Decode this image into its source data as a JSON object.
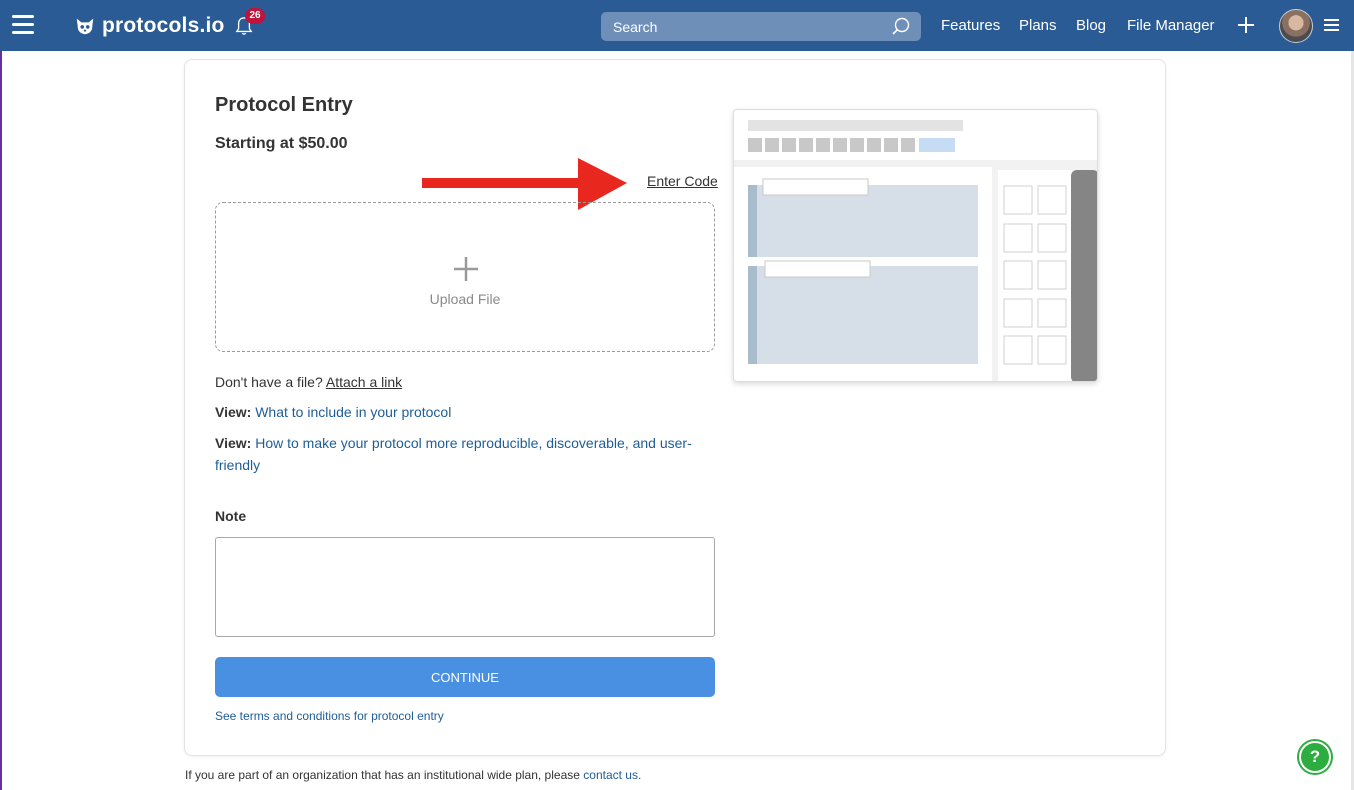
{
  "header": {
    "brand": "protocols.io",
    "notification_count": "26",
    "search_placeholder": "Search",
    "nav": [
      "Features",
      "Plans",
      "Blog",
      "File Manager"
    ]
  },
  "entry": {
    "title": "Protocol Entry",
    "price": "Starting at $50.00",
    "enter_code": "Enter Code",
    "upload_label": "Upload File",
    "no_file_text": "Don't have a file?",
    "attach_link": "Attach a link",
    "view_prefix": "View:",
    "view_link_1": "What to include in your protocol",
    "view_link_2": "How to make your protocol more reproducible, discoverable, and user-friendly",
    "note_label": "Note",
    "continue_label": "CONTINUE",
    "terms_link": "See terms and conditions for protocol entry"
  },
  "footer": {
    "text": "If you are part of an organization that has an institutional wide plan, please",
    "contact_link": "contact us."
  },
  "help_label": "?",
  "colors": {
    "topbar": "#2a5b95",
    "primary_button": "#4a90e2",
    "link": "#1f5d96",
    "badge": "#c0143c",
    "arrow": "#e8281e",
    "help": "#2dad3f"
  }
}
